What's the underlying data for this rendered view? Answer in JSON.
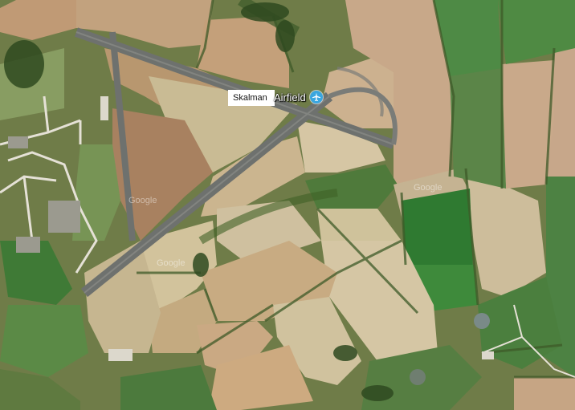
{
  "map": {
    "label_overlay": "Skalman",
    "place_name": "Airfield",
    "place_icon": "airport-icon",
    "place_icon_color": "#3aa6df",
    "watermark": "Google"
  }
}
